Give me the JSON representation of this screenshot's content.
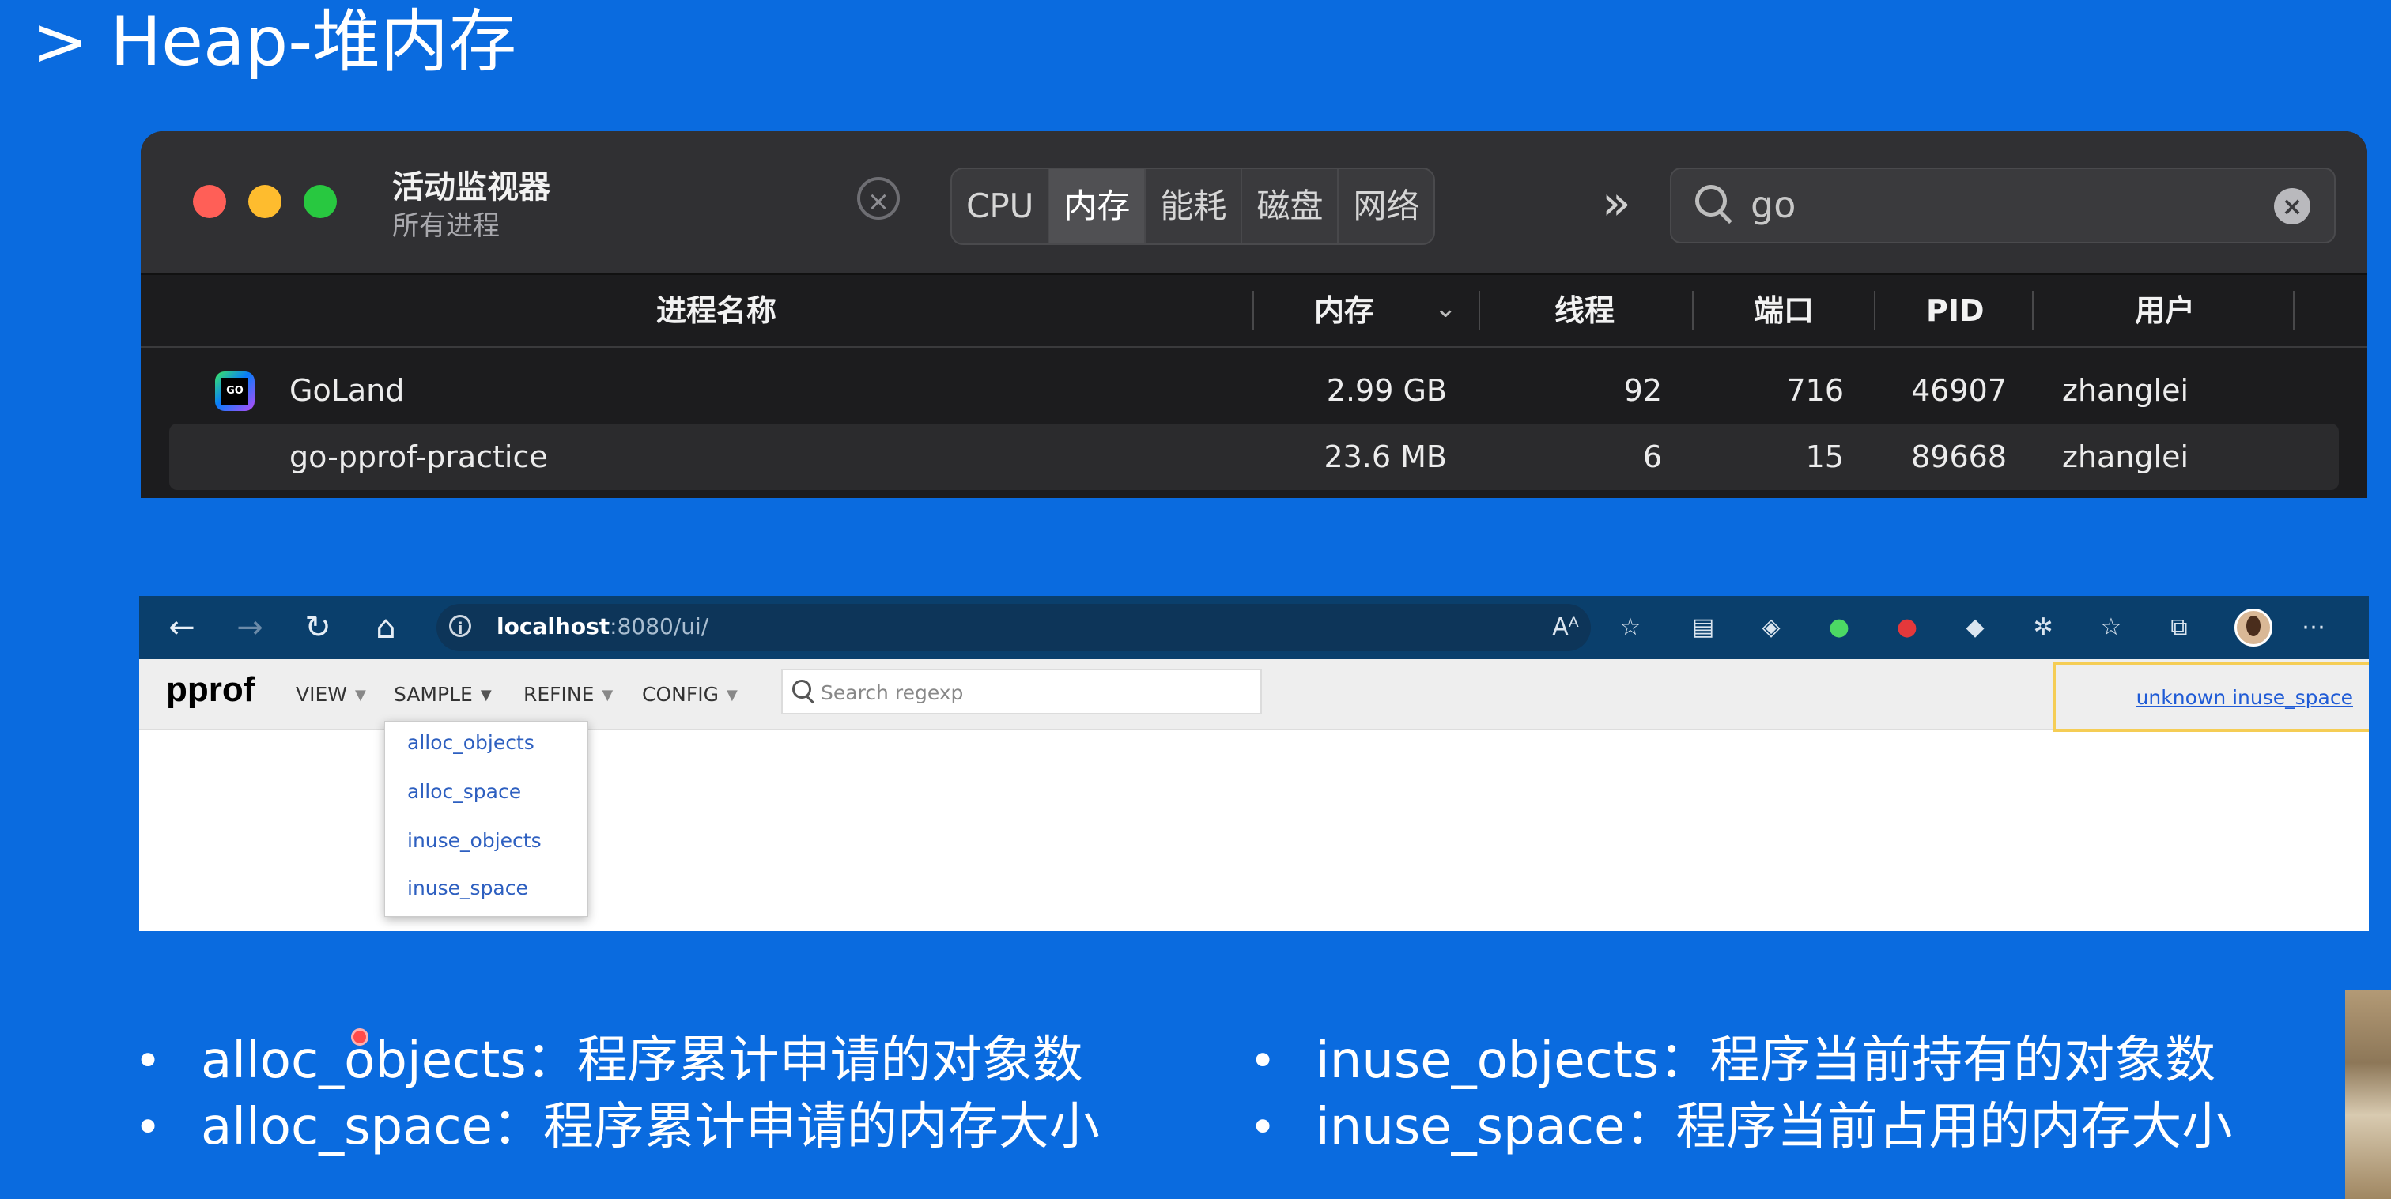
{
  "slide": {
    "title": "> Heap-堆内存"
  },
  "activity_monitor": {
    "title": "活动监视器",
    "subtitle": "所有进程",
    "stop_icon": "x-circle-icon",
    "tabs": [
      "CPU",
      "内存",
      "能耗",
      "磁盘",
      "网络"
    ],
    "active_tab": "内存",
    "more_icon": "chevrons-right-icon",
    "search_value": "go",
    "columns": {
      "name": "进程名称",
      "memory": "内存",
      "threads": "线程",
      "ports": "端口",
      "pid": "PID",
      "user": "用户"
    },
    "rows": [
      {
        "name": "GoLand",
        "icon": "goland-icon",
        "memory": "2.99 GB",
        "threads": "92",
        "ports": "716",
        "pid": "46907",
        "user": "zhanglei"
      },
      {
        "name": "go-pprof-practice",
        "memory": "23.6 MB",
        "threads": "6",
        "ports": "15",
        "pid": "89668",
        "user": "zhanglei"
      }
    ],
    "colors": {
      "red": "#ff5f57",
      "yellow": "#febc2e",
      "green": "#28c840"
    }
  },
  "browser": {
    "url_host": "localhost",
    "url_path": ":8080/ui/",
    "pprof": {
      "logo": "pprof",
      "menus": [
        "VIEW",
        "SAMPLE",
        "REFINE",
        "CONFIG"
      ],
      "search_placeholder": "Search regexp",
      "legend": "unknown inuse_space",
      "sample_options": [
        "alloc_objects",
        "alloc_space",
        "inuse_objects",
        "inuse_space"
      ]
    }
  },
  "bullets": {
    "left": [
      "alloc_objects：程序累计申请的对象数",
      "alloc_space：程序累计申请的内存大小"
    ],
    "right": [
      "inuse_objects：程序当前持有的对象数",
      "inuse_space：程序当前占用的内存大小"
    ]
  }
}
